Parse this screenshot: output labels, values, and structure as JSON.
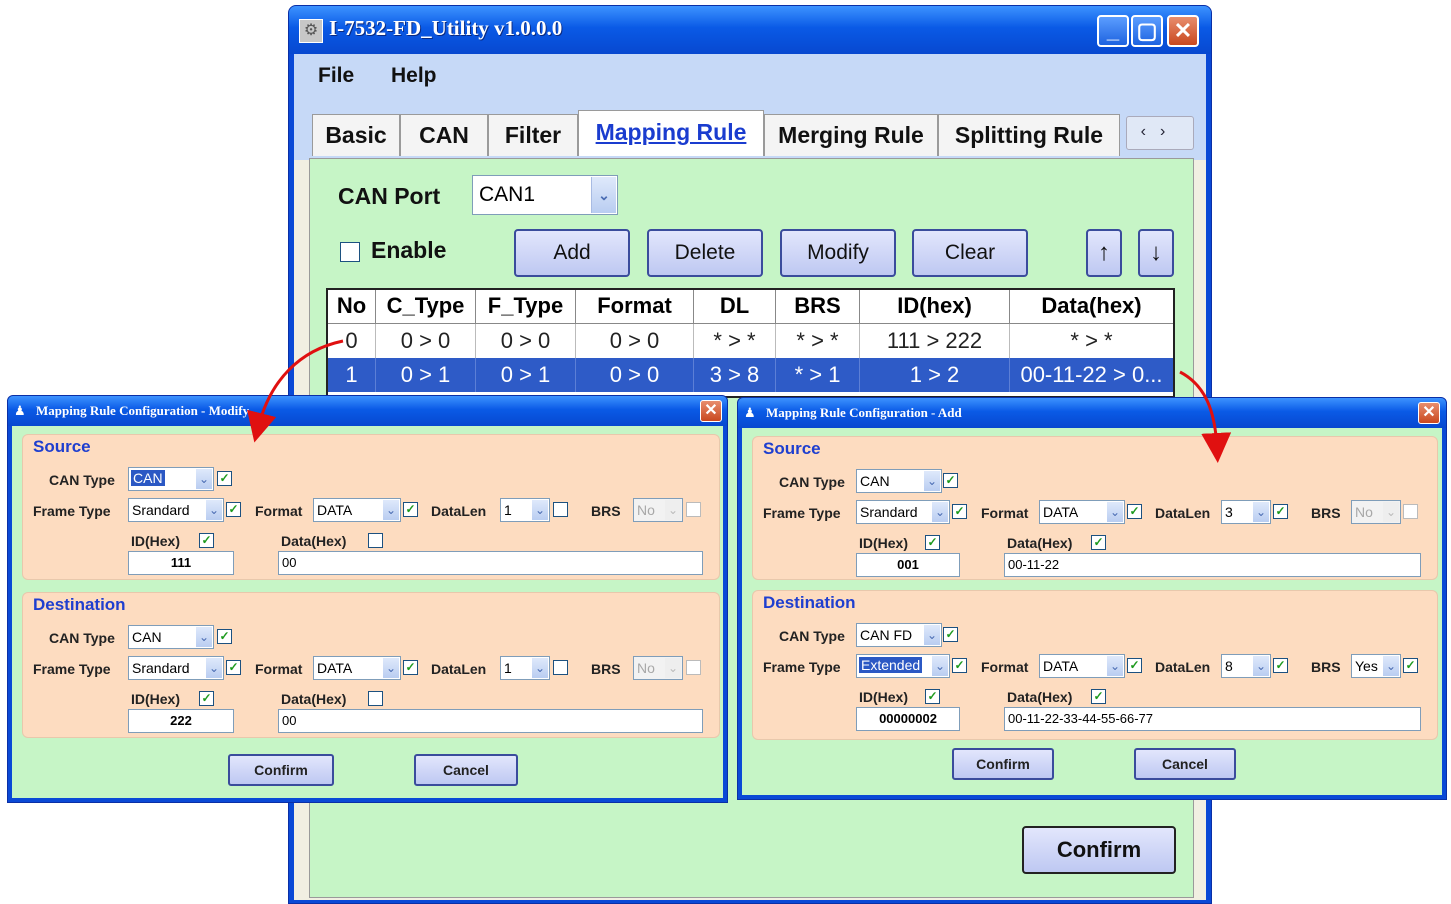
{
  "main": {
    "title": "I-7532-FD_Utility v1.0.0.0",
    "menu": [
      "File",
      "Help"
    ],
    "tabs": [
      "Basic",
      "CAN",
      "Filter",
      "Mapping Rule",
      "Merging Rule",
      "Splitting Rule"
    ],
    "active_tab": "Mapping Rule",
    "can_port_label": "CAN Port",
    "can_port_value": "CAN1",
    "enable_label": "Enable",
    "enable_checked": false,
    "buttons": {
      "add": "Add",
      "delete": "Delete",
      "modify": "Modify",
      "clear": "Clear",
      "up": "↑",
      "down": "↓",
      "confirm": "Confirm"
    },
    "grid": {
      "columns": [
        "No",
        "C_Type",
        "F_Type",
        "Format",
        "DL",
        "BRS",
        "ID(hex)",
        "Data(hex)"
      ],
      "rows": [
        [
          "0",
          "0 > 0",
          "0 > 0",
          "0 > 0",
          "* > *",
          "* > *",
          "111 > 222",
          "* > *"
        ],
        [
          "1",
          "0 > 1",
          "0 > 1",
          "0 > 0",
          "3 > 8",
          "* > 1",
          "1 > 2",
          "00-11-22 > 0..."
        ]
      ],
      "selected_row": 1
    }
  },
  "dialog_modify": {
    "title": "Mapping Rule Configuration - Modify",
    "source": {
      "heading": "Source",
      "can_type_label": "CAN Type",
      "can_type": "CAN",
      "frame_type_label": "Frame Type",
      "frame_type": "Srandard",
      "format_label": "Format",
      "format": "DATA",
      "datalen_label": "DataLen",
      "datalen": "1",
      "brs_label": "BRS",
      "brs": "No",
      "id_label": "ID(Hex)",
      "id": "111",
      "data_label": "Data(Hex)",
      "data": "00"
    },
    "destination": {
      "heading": "Destination",
      "can_type_label": "CAN Type",
      "can_type": "CAN",
      "frame_type_label": "Frame Type",
      "frame_type": "Srandard",
      "format_label": "Format",
      "format": "DATA",
      "datalen_label": "DataLen",
      "datalen": "1",
      "brs_label": "BRS",
      "brs": "No",
      "id_label": "ID(Hex)",
      "id": "222",
      "data_label": "Data(Hex)",
      "data": "00"
    },
    "confirm": "Confirm",
    "cancel": "Cancel"
  },
  "dialog_add": {
    "title": "Mapping Rule Configuration - Add",
    "source": {
      "heading": "Source",
      "can_type_label": "CAN Type",
      "can_type": "CAN",
      "frame_type_label": "Frame Type",
      "frame_type": "Srandard",
      "format_label": "Format",
      "format": "DATA",
      "datalen_label": "DataLen",
      "datalen": "3",
      "brs_label": "BRS",
      "brs": "No",
      "id_label": "ID(Hex)",
      "id": "001",
      "data_label": "Data(Hex)",
      "data": "00-11-22"
    },
    "destination": {
      "heading": "Destination",
      "can_type_label": "CAN Type",
      "can_type": "CAN FD",
      "frame_type_label": "Frame Type",
      "frame_type": "Extended",
      "format_label": "Format",
      "format": "DATA",
      "datalen_label": "DataLen",
      "datalen": "8",
      "brs_label": "BRS",
      "brs": "Yes",
      "id_label": "ID(Hex)",
      "id": "00000002",
      "data_label": "Data(Hex)",
      "data": "00-11-22-33-44-55-66-77"
    },
    "confirm": "Confirm",
    "cancel": "Cancel"
  },
  "colors": {
    "accent": "#1f3fcf",
    "panel": "#c6f5c6",
    "group": "#fddcc0",
    "arrow": "#e01010",
    "selection": "#2e5bc7"
  }
}
